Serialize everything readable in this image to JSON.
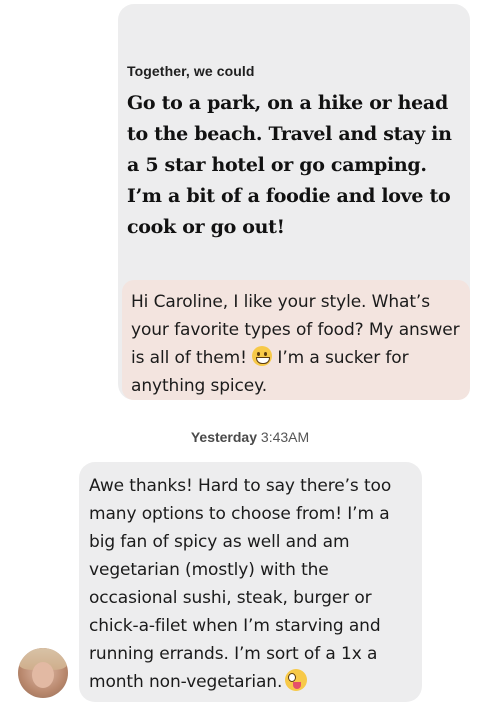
{
  "prompt": {
    "label": "Together, we could",
    "answer": "Go to a park, on a hike or head to the beach. Travel and stay in a 5 star hotel or go camping. I’m a bit of a foodie and love to cook or go out!"
  },
  "outgoing_reply": {
    "text_before_emoji": "Hi Caroline, I like your style. What’s your favorite types of food? My answer is all of them! ",
    "emoji": "grinning-face-emoji",
    "text_after_emoji": " I’m a sucker for anything spicey."
  },
  "timestamp": {
    "day": "Yesterday",
    "time": "3:43AM"
  },
  "incoming_message": {
    "text": "Awe thanks! Hard to say  there’s too many options to choose from! I’m a big fan of spicy as well and am vegetarian (mostly) with the occasional sushi, steak, burger or chick-a-filet when I’m starving and running errands. I’m sort of a 1x a month non-vegetarian.",
    "emoji": "zany-face-emoji"
  },
  "colors": {
    "prompt_card_bg": "#ededee",
    "outgoing_bubble_bg": "#f3e4df",
    "incoming_bubble_bg": "#ededee",
    "text": "#1b1b1b",
    "timestamp": "#555555"
  }
}
